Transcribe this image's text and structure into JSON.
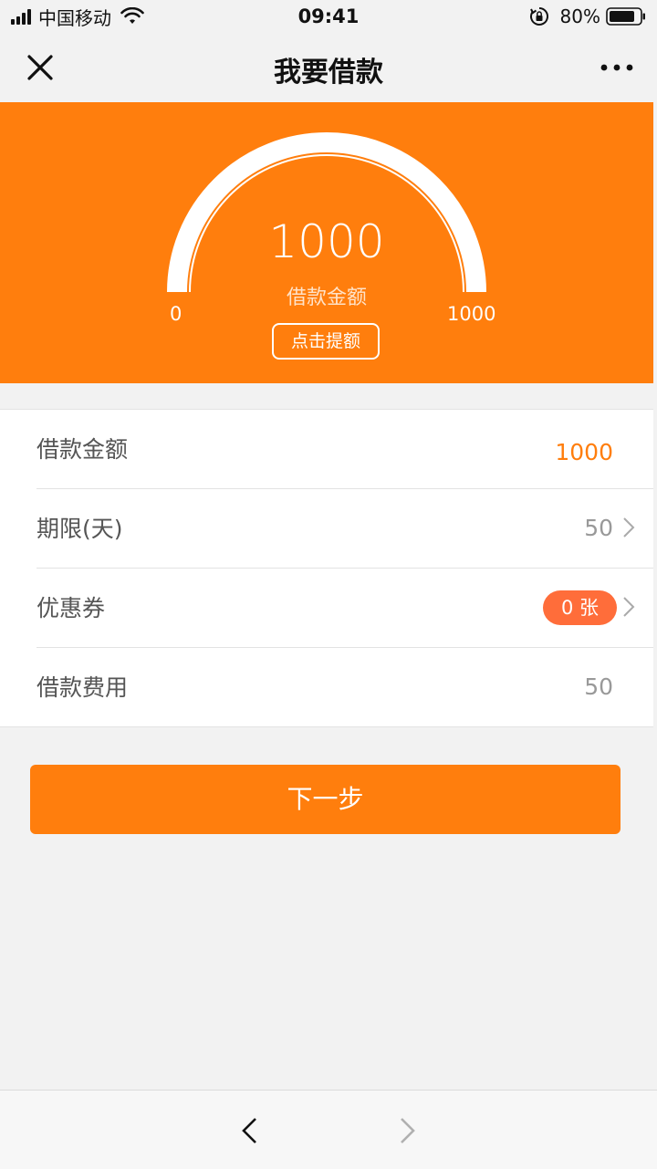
{
  "status_bar": {
    "carrier": "中国移动",
    "time": "09:41",
    "battery": "80%"
  },
  "nav": {
    "title": "我要借款"
  },
  "gauge": {
    "value": "1000",
    "label": "借款金额",
    "min": "0",
    "max": "1000",
    "raise_button": "点击提额"
  },
  "form": {
    "rows": [
      {
        "label": "借款金额",
        "value": "1000"
      },
      {
        "label": "期限(天)",
        "value": "50"
      },
      {
        "label": "优惠券",
        "value": "0 张"
      },
      {
        "label": "借款费用",
        "value": "50"
      }
    ]
  },
  "next_button": "下一步",
  "colors": {
    "brand_orange": "#ff7e0d",
    "badge_orange": "#ff6d3a",
    "background": "#f2f2f2"
  }
}
